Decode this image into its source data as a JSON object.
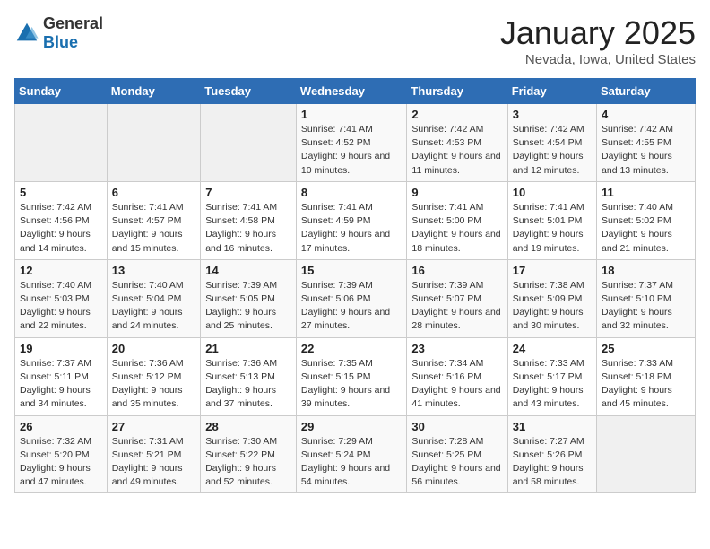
{
  "header": {
    "logo_general": "General",
    "logo_blue": "Blue",
    "title": "January 2025",
    "location": "Nevada, Iowa, United States"
  },
  "days_of_week": [
    "Sunday",
    "Monday",
    "Tuesday",
    "Wednesday",
    "Thursday",
    "Friday",
    "Saturday"
  ],
  "weeks": [
    {
      "days": [
        {
          "number": "",
          "info": ""
        },
        {
          "number": "",
          "info": ""
        },
        {
          "number": "",
          "info": ""
        },
        {
          "number": "1",
          "info": "Sunrise: 7:41 AM\nSunset: 4:52 PM\nDaylight: 9 hours\nand 10 minutes."
        },
        {
          "number": "2",
          "info": "Sunrise: 7:42 AM\nSunset: 4:53 PM\nDaylight: 9 hours\nand 11 minutes."
        },
        {
          "number": "3",
          "info": "Sunrise: 7:42 AM\nSunset: 4:54 PM\nDaylight: 9 hours\nand 12 minutes."
        },
        {
          "number": "4",
          "info": "Sunrise: 7:42 AM\nSunset: 4:55 PM\nDaylight: 9 hours\nand 13 minutes."
        }
      ]
    },
    {
      "days": [
        {
          "number": "5",
          "info": "Sunrise: 7:42 AM\nSunset: 4:56 PM\nDaylight: 9 hours\nand 14 minutes."
        },
        {
          "number": "6",
          "info": "Sunrise: 7:41 AM\nSunset: 4:57 PM\nDaylight: 9 hours\nand 15 minutes."
        },
        {
          "number": "7",
          "info": "Sunrise: 7:41 AM\nSunset: 4:58 PM\nDaylight: 9 hours\nand 16 minutes."
        },
        {
          "number": "8",
          "info": "Sunrise: 7:41 AM\nSunset: 4:59 PM\nDaylight: 9 hours\nand 17 minutes."
        },
        {
          "number": "9",
          "info": "Sunrise: 7:41 AM\nSunset: 5:00 PM\nDaylight: 9 hours\nand 18 minutes."
        },
        {
          "number": "10",
          "info": "Sunrise: 7:41 AM\nSunset: 5:01 PM\nDaylight: 9 hours\nand 19 minutes."
        },
        {
          "number": "11",
          "info": "Sunrise: 7:40 AM\nSunset: 5:02 PM\nDaylight: 9 hours\nand 21 minutes."
        }
      ]
    },
    {
      "days": [
        {
          "number": "12",
          "info": "Sunrise: 7:40 AM\nSunset: 5:03 PM\nDaylight: 9 hours\nand 22 minutes."
        },
        {
          "number": "13",
          "info": "Sunrise: 7:40 AM\nSunset: 5:04 PM\nDaylight: 9 hours\nand 24 minutes."
        },
        {
          "number": "14",
          "info": "Sunrise: 7:39 AM\nSunset: 5:05 PM\nDaylight: 9 hours\nand 25 minutes."
        },
        {
          "number": "15",
          "info": "Sunrise: 7:39 AM\nSunset: 5:06 PM\nDaylight: 9 hours\nand 27 minutes."
        },
        {
          "number": "16",
          "info": "Sunrise: 7:39 AM\nSunset: 5:07 PM\nDaylight: 9 hours\nand 28 minutes."
        },
        {
          "number": "17",
          "info": "Sunrise: 7:38 AM\nSunset: 5:09 PM\nDaylight: 9 hours\nand 30 minutes."
        },
        {
          "number": "18",
          "info": "Sunrise: 7:37 AM\nSunset: 5:10 PM\nDaylight: 9 hours\nand 32 minutes."
        }
      ]
    },
    {
      "days": [
        {
          "number": "19",
          "info": "Sunrise: 7:37 AM\nSunset: 5:11 PM\nDaylight: 9 hours\nand 34 minutes."
        },
        {
          "number": "20",
          "info": "Sunrise: 7:36 AM\nSunset: 5:12 PM\nDaylight: 9 hours\nand 35 minutes."
        },
        {
          "number": "21",
          "info": "Sunrise: 7:36 AM\nSunset: 5:13 PM\nDaylight: 9 hours\nand 37 minutes."
        },
        {
          "number": "22",
          "info": "Sunrise: 7:35 AM\nSunset: 5:15 PM\nDaylight: 9 hours\nand 39 minutes."
        },
        {
          "number": "23",
          "info": "Sunrise: 7:34 AM\nSunset: 5:16 PM\nDaylight: 9 hours\nand 41 minutes."
        },
        {
          "number": "24",
          "info": "Sunrise: 7:33 AM\nSunset: 5:17 PM\nDaylight: 9 hours\nand 43 minutes."
        },
        {
          "number": "25",
          "info": "Sunrise: 7:33 AM\nSunset: 5:18 PM\nDaylight: 9 hours\nand 45 minutes."
        }
      ]
    },
    {
      "days": [
        {
          "number": "26",
          "info": "Sunrise: 7:32 AM\nSunset: 5:20 PM\nDaylight: 9 hours\nand 47 minutes."
        },
        {
          "number": "27",
          "info": "Sunrise: 7:31 AM\nSunset: 5:21 PM\nDaylight: 9 hours\nand 49 minutes."
        },
        {
          "number": "28",
          "info": "Sunrise: 7:30 AM\nSunset: 5:22 PM\nDaylight: 9 hours\nand 52 minutes."
        },
        {
          "number": "29",
          "info": "Sunrise: 7:29 AM\nSunset: 5:24 PM\nDaylight: 9 hours\nand 54 minutes."
        },
        {
          "number": "30",
          "info": "Sunrise: 7:28 AM\nSunset: 5:25 PM\nDaylight: 9 hours\nand 56 minutes."
        },
        {
          "number": "31",
          "info": "Sunrise: 7:27 AM\nSunset: 5:26 PM\nDaylight: 9 hours\nand 58 minutes."
        },
        {
          "number": "",
          "info": ""
        }
      ]
    }
  ]
}
